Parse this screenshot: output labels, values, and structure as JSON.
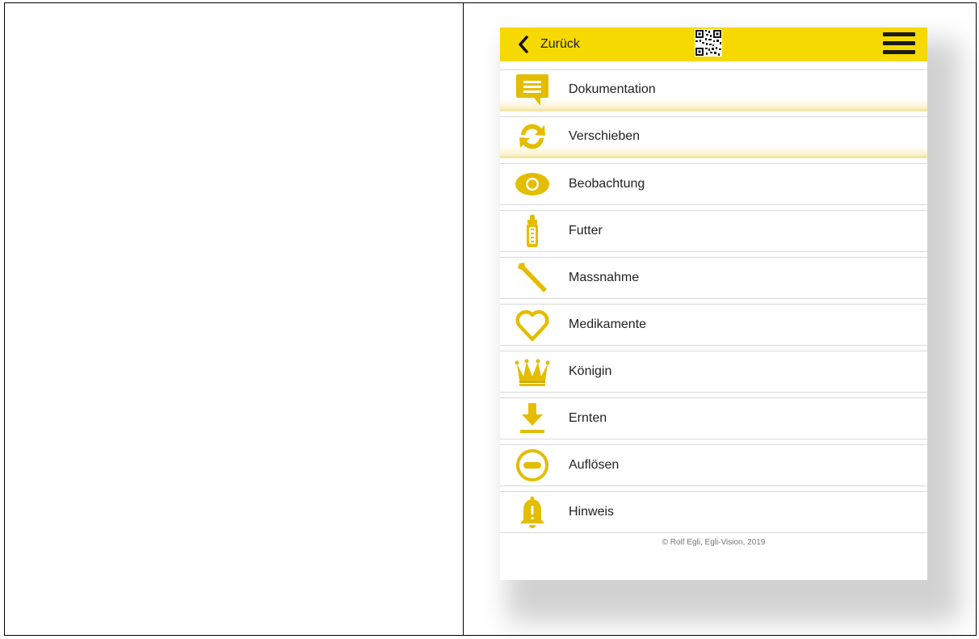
{
  "header": {
    "back_label": "Zurück"
  },
  "menu_items": [
    {
      "label": "Dokumentation",
      "icon": "speech-bubble-icon"
    },
    {
      "label": "Verschieben",
      "icon": "refresh-arrows-icon"
    },
    {
      "label": "Beobachtung",
      "icon": "eye-icon"
    },
    {
      "label": "Futter",
      "icon": "baby-bottle-icon"
    },
    {
      "label": "Massnahme",
      "icon": "hive-tool-icon"
    },
    {
      "label": "Medikamente",
      "icon": "heart-icon"
    },
    {
      "label": "Königin",
      "icon": "crown-icon"
    },
    {
      "label": "Ernten",
      "icon": "download-arrow-icon"
    },
    {
      "label": "Auflösen",
      "icon": "minus-circle-icon"
    },
    {
      "label": "Hinweis",
      "icon": "alert-bell-icon"
    }
  ],
  "footer": {
    "text": "© Rolf Egli, Egli-Vision, 2019"
  },
  "colors": {
    "accent": "#f6d900",
    "icon": "#e3bd00",
    "text": "#222222"
  }
}
